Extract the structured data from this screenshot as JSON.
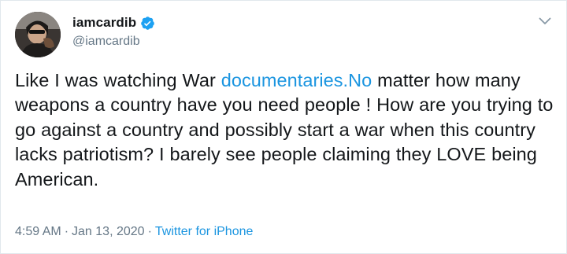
{
  "user": {
    "display_name": "iamcardib",
    "handle": "@iamcardib",
    "verified_color": "#1da1f2"
  },
  "tweet": {
    "text_before": "Like I was watching War ",
    "link_text": "documentaries.No",
    "text_after": " matter how many weapons a country have you need people ! How are you trying to go against a country and possibly start a war when this country lacks patriotism? I barely see people claiming they LOVE being American."
  },
  "meta": {
    "time": "4:59 AM",
    "separator": "·",
    "date": "Jan 13, 2020",
    "source": "Twitter for iPhone"
  },
  "icons": {
    "verified": "verified-badge-icon",
    "caret": "chevron-down-icon"
  },
  "colors": {
    "link": "#1b95e0",
    "secondary_text": "#657786",
    "border": "#e1e8ed"
  }
}
